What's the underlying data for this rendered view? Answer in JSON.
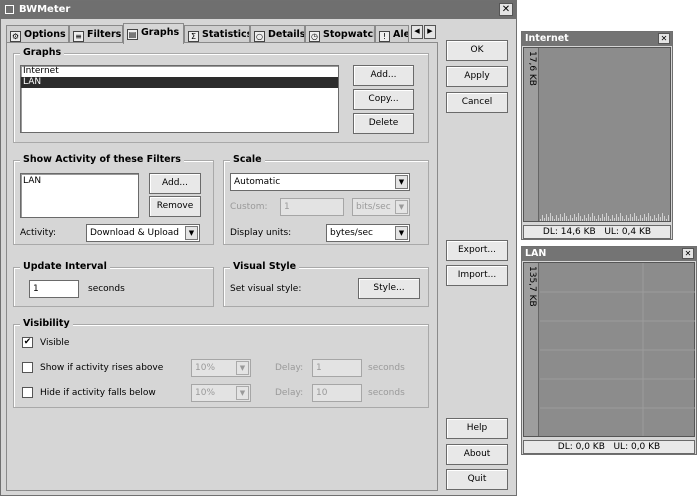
{
  "window": {
    "title": "BWMeter"
  },
  "tabs": [
    {
      "label": "Options",
      "icon": "gear-icon"
    },
    {
      "label": "Filters",
      "icon": "filter-icon"
    },
    {
      "label": "Graphs",
      "icon": "graph-icon"
    },
    {
      "label": "Statistics",
      "icon": "sigma-icon"
    },
    {
      "label": "Details",
      "icon": "magnifier-icon"
    },
    {
      "label": "Stopwatch",
      "icon": "stopwatch-icon"
    },
    {
      "label": "Aler",
      "icon": "alert-icon"
    }
  ],
  "graphs_group": {
    "title": "Graphs",
    "items": [
      "Internet",
      "LAN"
    ],
    "add": "Add...",
    "copy": "Copy...",
    "delete": "Delete"
  },
  "filters_group": {
    "title": "Show Activity of these Filters",
    "items": [
      "LAN"
    ],
    "add": "Add...",
    "remove": "Remove",
    "activity_label": "Activity:",
    "activity_value": "Download & Upload"
  },
  "scale_group": {
    "title": "Scale",
    "scale_value": "Automatic",
    "custom_label": "Custom:",
    "custom_value": "1",
    "custom_unit": "bits/sec",
    "display_units_label": "Display units:",
    "display_units_value": "bytes/sec"
  },
  "update_group": {
    "title": "Update Interval",
    "value": "1",
    "unit": "seconds"
  },
  "visual_group": {
    "title": "Visual Style",
    "label": "Set visual style:",
    "button": "Style..."
  },
  "visibility_group": {
    "title": "Visibility",
    "visible_label": "Visible",
    "rises_label": "Show if activity rises above",
    "rises_percent": "10%",
    "falls_label": "Hide if activity falls below",
    "falls_percent": "10%",
    "delay_label": "Delay:",
    "rises_delay": "1",
    "falls_delay": "10",
    "seconds": "seconds"
  },
  "side_buttons": {
    "ok": "OK",
    "apply": "Apply",
    "cancel": "Cancel",
    "export": "Export...",
    "import": "Import...",
    "help": "Help",
    "about": "About",
    "quit": "Quit"
  },
  "internet_window": {
    "title": "Internet",
    "scale": "17,6 KB",
    "dl": "DL: 14,6 KB",
    "ul": "UL: 0,4 KB"
  },
  "lan_window": {
    "title": "LAN",
    "scale": "135,7 KB",
    "dl": "DL: 0,0 KB",
    "ul": "UL: 0,0 KB"
  },
  "close_glyph": "✕",
  "colors": {
    "titlebar": "#6f6f6f",
    "selection": "#2c2c2c",
    "graph_bg": "#8c8c8c"
  }
}
